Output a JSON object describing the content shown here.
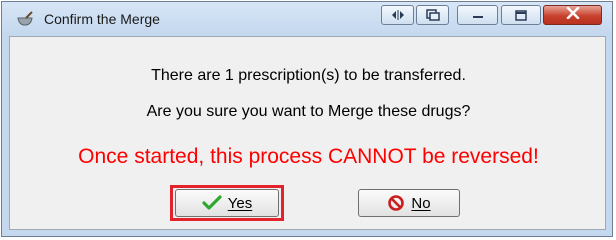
{
  "window": {
    "title": "Confirm the Merge"
  },
  "message": {
    "line1": "There are 1 prescription(s) to be transferred.",
    "line2": "Are you sure you want to Merge these drugs?",
    "warning": "Once started, this process CANNOT be reversed!"
  },
  "buttons": {
    "yes": "Yes",
    "no": "No"
  },
  "colors": {
    "warning": "#ff0000",
    "highlight": "#e2232b",
    "check": "#2fa82f",
    "no_icon": "#c81e1e"
  },
  "icons": {
    "app": "mortar-pestle-icon",
    "titlebar": [
      "restore-arrows-icon",
      "copy-window-icon",
      "minimize-icon",
      "maximize-icon",
      "close-icon"
    ],
    "yes": "checkmark-icon",
    "no": "no-circle-icon"
  }
}
